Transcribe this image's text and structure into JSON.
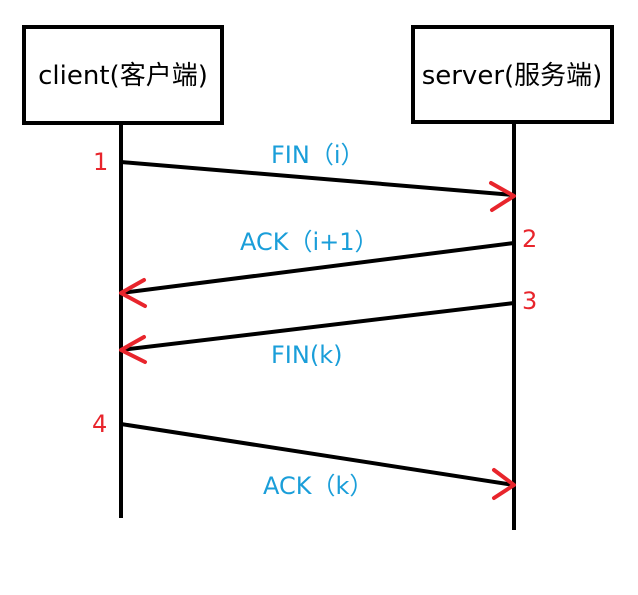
{
  "participants": {
    "client": "client(客户端)",
    "server": "server(服务端)"
  },
  "messages": [
    {
      "step": "1",
      "label": "FIN（i）",
      "from": "client",
      "to": "server"
    },
    {
      "step": "2",
      "label": "ACK（i+1）",
      "from": "server",
      "to": "client"
    },
    {
      "step": "3",
      "label": "FIN(k)",
      "from": "server",
      "to": "client"
    },
    {
      "step": "4",
      "label": "ACK（k）",
      "from": "client",
      "to": "server"
    }
  ],
  "colors": {
    "label": "#1a9ed9",
    "step": "#e8252c",
    "arrowhead": "#e8252c",
    "line": "#000000"
  }
}
